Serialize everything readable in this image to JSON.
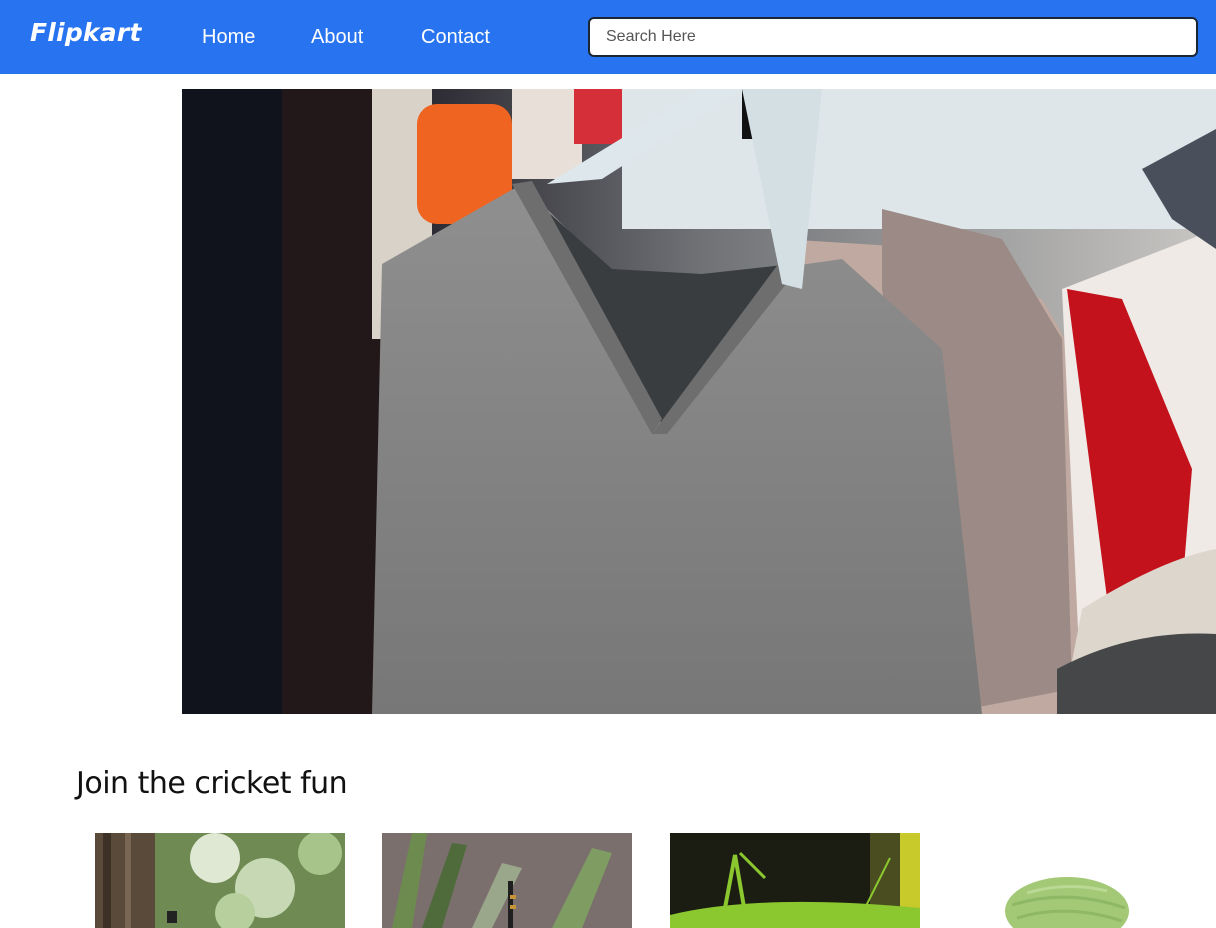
{
  "header": {
    "logo": "Flipkart",
    "nav": [
      {
        "label": "Home"
      },
      {
        "label": "About"
      },
      {
        "label": "Contact"
      }
    ],
    "search": {
      "placeholder": "Search Here",
      "value": ""
    }
  },
  "colors": {
    "navbar": "#2874f0",
    "text_on_nav": "#ffffff"
  },
  "hero": {
    "image": "clothes-rack-sweaters"
  },
  "section": {
    "title": "Join the cricket fun",
    "cards": [
      {
        "image": "insect-on-tree-bark"
      },
      {
        "image": "dragonfly-on-leaves"
      },
      {
        "image": "green-grasshopper"
      },
      {
        "image": "green-yarn-ball"
      }
    ]
  }
}
